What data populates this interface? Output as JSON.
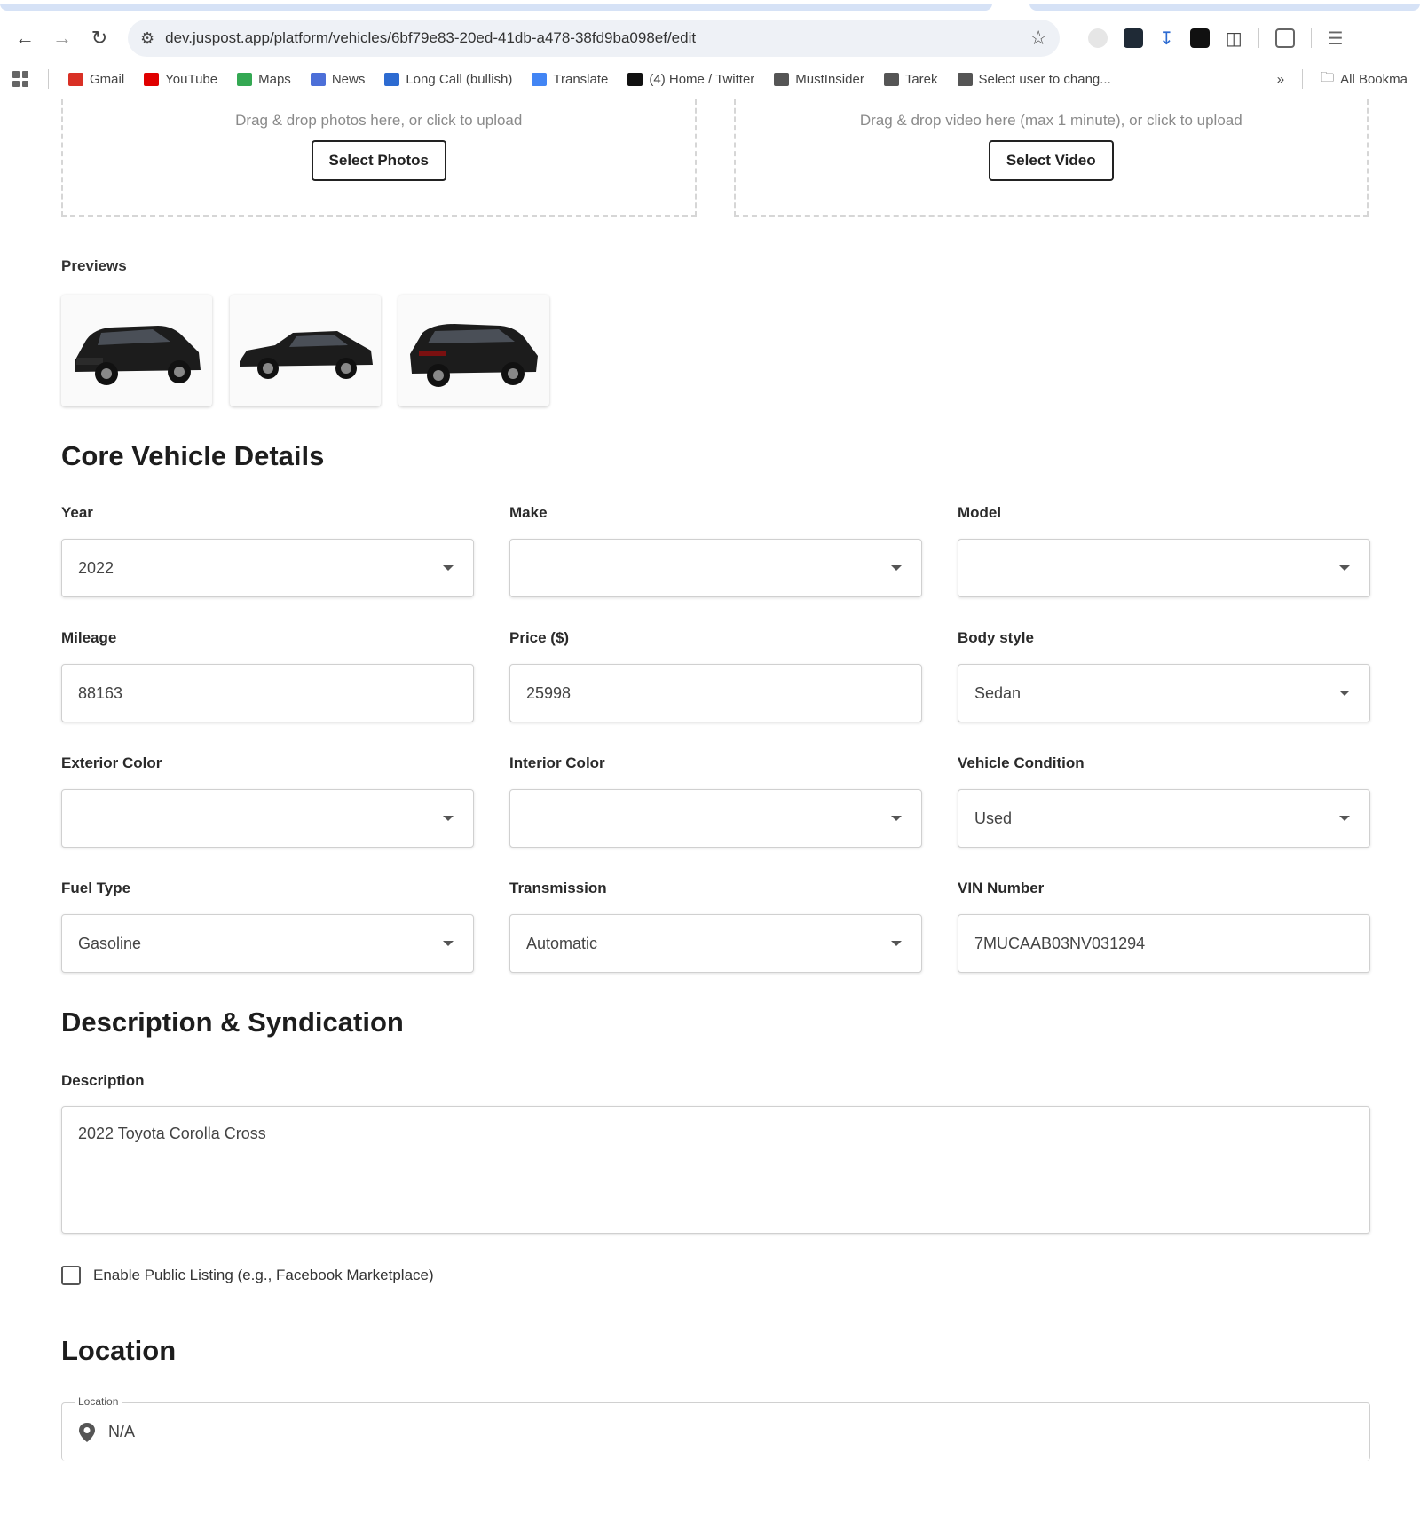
{
  "browser": {
    "url": "dev.juspost.app/platform/vehicles/6bf79e83-20ed-41db-a478-38fd9ba098ef/edit",
    "bookmarks": [
      {
        "label": "Gmail",
        "icon": "gmail-icon",
        "color": "#d93025"
      },
      {
        "label": "YouTube",
        "icon": "youtube-icon",
        "color": "#e00000"
      },
      {
        "label": "Maps",
        "icon": "maps-pin-icon",
        "color": "#34a853"
      },
      {
        "label": "News",
        "icon": "news-icon",
        "color": "#4c6fd8"
      },
      {
        "label": "Long Call (bullish)",
        "icon": "chart-icon",
        "color": "#2d6bd1"
      },
      {
        "label": "Translate",
        "icon": "translate-icon",
        "color": "#4285f4"
      },
      {
        "label": "(4) Home / Twitter",
        "icon": "x-icon",
        "color": "#111111"
      },
      {
        "label": "MustInsider",
        "icon": "globe-icon",
        "color": "#555555"
      },
      {
        "label": "Tarek",
        "icon": "folder-icon",
        "color": "#555555"
      },
      {
        "label": "Select user to chang...",
        "icon": "globe-icon",
        "color": "#555555"
      }
    ],
    "more": "»",
    "all_bookmarks": "All Bookma"
  },
  "uploads": {
    "photos_hint": "Drag & drop photos here, or click to upload",
    "photos_button": "Select Photos",
    "video_hint": "Drag & drop video here (max 1 minute), or click to upload",
    "video_button": "Select Video"
  },
  "previews": {
    "label": "Previews",
    "thumbnails": [
      "front-three-quarter",
      "side-profile",
      "rear-three-quarter"
    ]
  },
  "core": {
    "title": "Core Vehicle Details",
    "fields": [
      {
        "label": "Year",
        "value": "2022",
        "type": "select"
      },
      {
        "label": "Make",
        "value": "",
        "type": "select"
      },
      {
        "label": "Model",
        "value": "",
        "type": "select"
      },
      {
        "label": "Mileage",
        "value": "88163",
        "type": "input"
      },
      {
        "label": "Price ($)",
        "value": "25998",
        "type": "input"
      },
      {
        "label": "Body style",
        "value": "Sedan",
        "type": "select"
      },
      {
        "label": "Exterior Color",
        "value": "",
        "type": "select"
      },
      {
        "label": "Interior Color",
        "value": "",
        "type": "select"
      },
      {
        "label": "Vehicle Condition",
        "value": "Used",
        "type": "select"
      },
      {
        "label": "Fuel Type",
        "value": "Gasoline",
        "type": "select"
      },
      {
        "label": "Transmission",
        "value": "Automatic",
        "type": "select"
      },
      {
        "label": "VIN Number",
        "value": "7MUCAAB03NV031294",
        "type": "input"
      }
    ]
  },
  "description": {
    "title": "Description & Syndication",
    "label": "Description",
    "value": "2022 Toyota Corolla Cross",
    "checkbox_label": "Enable Public Listing (e.g., Facebook Marketplace)"
  },
  "location": {
    "title": "Location",
    "field_label": "Location",
    "value": "N/A"
  }
}
